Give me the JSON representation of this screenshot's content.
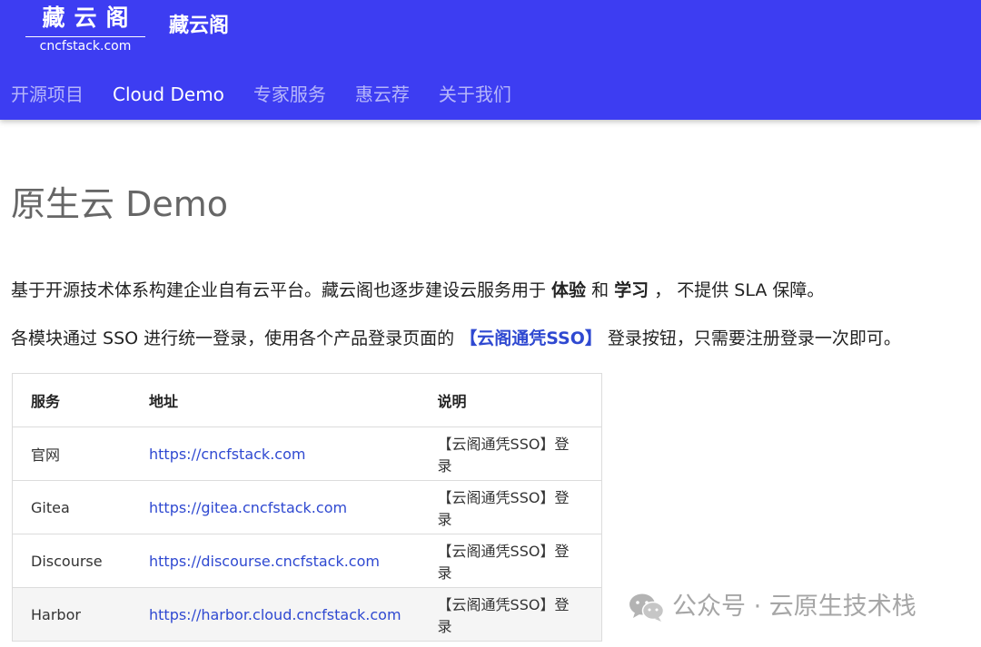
{
  "header": {
    "logo_main": "藏云阁",
    "logo_sub": "cncfstack.com",
    "site_name": "藏云阁",
    "nav": [
      {
        "label": "开源项目"
      },
      {
        "label": "Cloud Demo"
      },
      {
        "label": "专家服务"
      },
      {
        "label": "惠云荐"
      },
      {
        "label": "关于我们"
      }
    ]
  },
  "page": {
    "title": "原生云 Demo",
    "intro": {
      "part1": "基于开源技术体系构建企业自有云平台。藏云阁也逐步建设云服务用于 ",
      "bold1": "体验",
      "part2": " 和 ",
      "bold2": "学习",
      "part3": " ， 不提供 SLA 保障。"
    },
    "sso": {
      "part1": "各模块通过 SSO 进行统一登录，使用各个产品登录页面的 ",
      "link": "【云阁通凭SSO】",
      "part2": " 登录按钮，只需要注册登录一次即可。"
    }
  },
  "table": {
    "headers": [
      "服务",
      "地址",
      "说明"
    ],
    "rows": [
      {
        "service": "官网",
        "url": "https://cncfstack.com",
        "note": "【云阁通凭SSO】登录"
      },
      {
        "service": "Gitea",
        "url": "https://gitea.cncfstack.com",
        "note": "【云阁通凭SSO】登录"
      },
      {
        "service": "Discourse",
        "url": "https://discourse.cncfstack.com",
        "note": "【云阁通凭SSO】登录"
      },
      {
        "service": "Harbor",
        "url": "https://harbor.cloud.cncfstack.com",
        "note": "【云阁通凭SSO】登录"
      }
    ]
  },
  "watermark": {
    "text": "公众号 · 云原生技术栈",
    "icon": "wechat-icon"
  },
  "colors": {
    "header_bg": "#3d3df2",
    "link": "#2f49d1"
  }
}
